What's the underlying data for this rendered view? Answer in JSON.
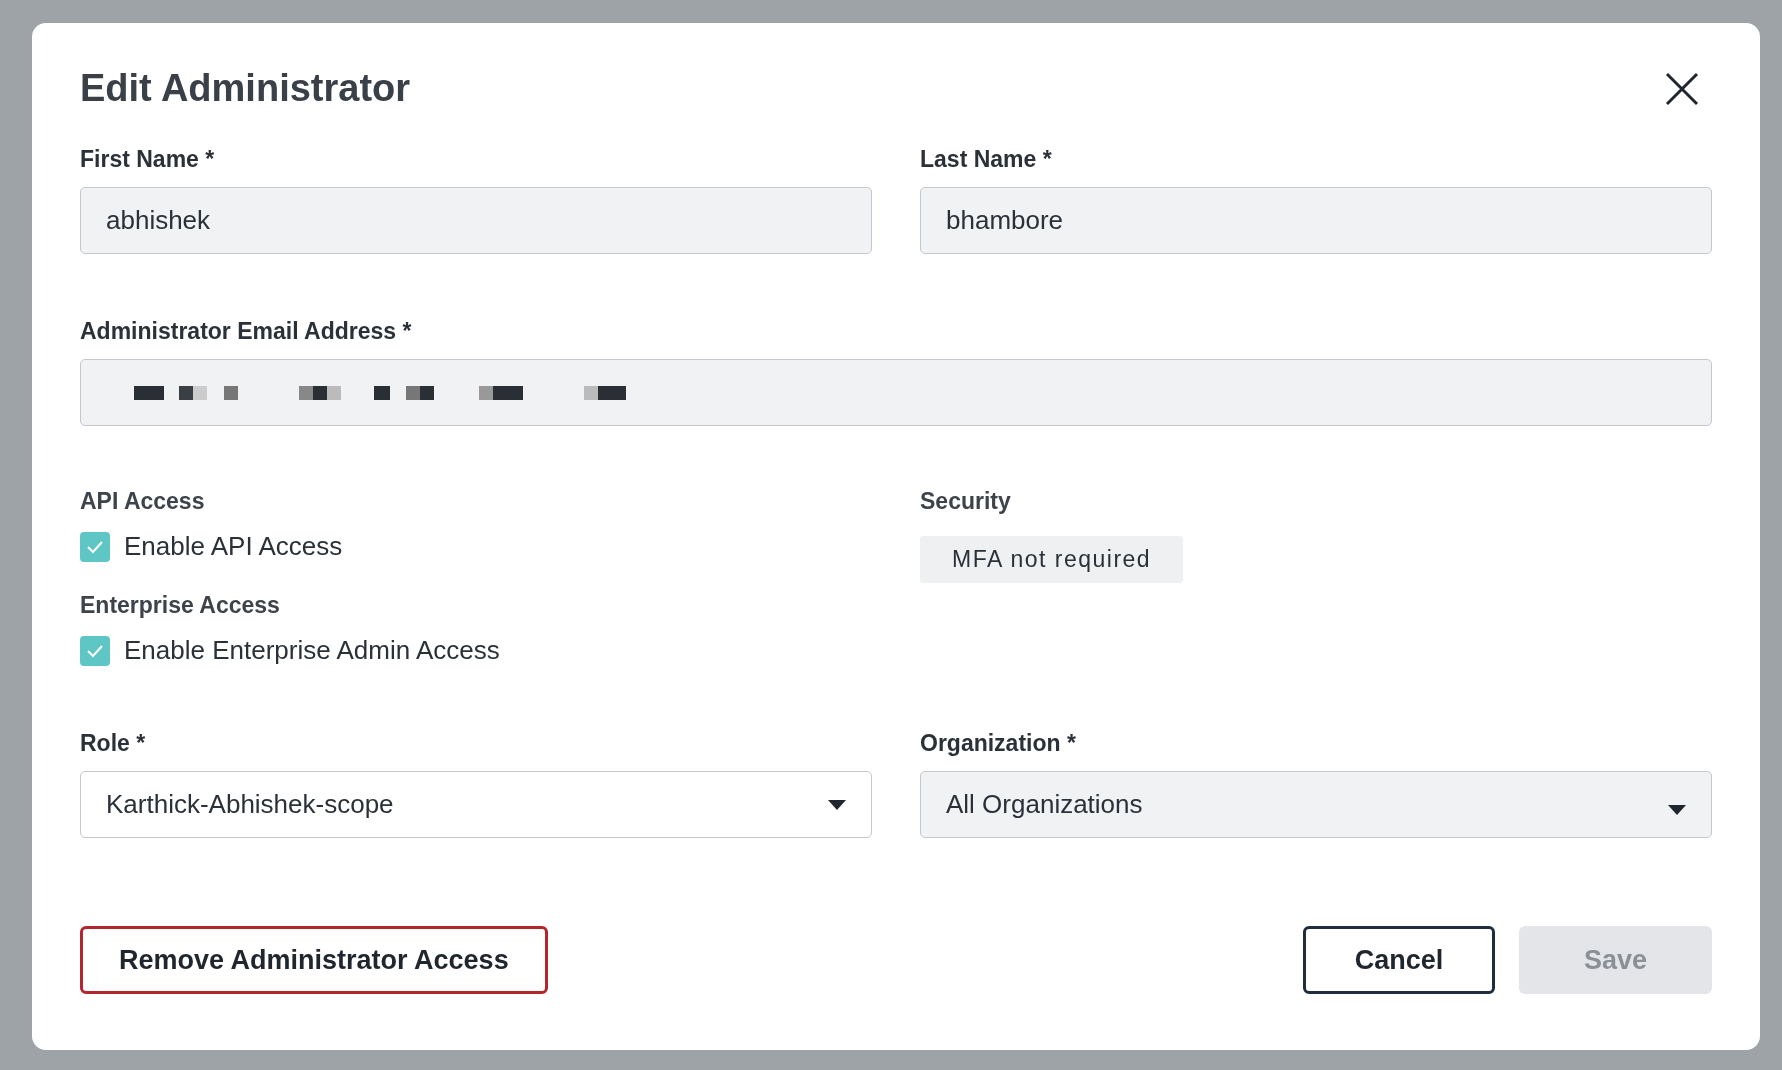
{
  "dialog": {
    "title": "Edit Administrator"
  },
  "name_fields": [
    {
      "label": "First Name *",
      "value": "abhishek",
      "disabled": true
    },
    {
      "label": "Last Name *",
      "value": "bhambore",
      "disabled": true
    }
  ],
  "email_field": {
    "label": "Administrator Email Address *",
    "disabled": true
  },
  "api_access": {
    "heading": "API Access",
    "label": "Enable API Access",
    "checked": true
  },
  "enterprise_access": {
    "heading": "Enterprise Access",
    "label": "Enable Enterprise Admin Access",
    "checked": true
  },
  "security": {
    "heading": "Security",
    "badge": "MFA not required"
  },
  "selects": [
    {
      "label": "Role *",
      "value": "Karthick-Abhishek-scope",
      "disabled": false
    },
    {
      "label": "Organization *",
      "value": "All Organizations",
      "disabled": true
    }
  ],
  "buttons": [
    {
      "kind": "danger",
      "label": "Remove Administrator Access"
    },
    {
      "kind": "secondary",
      "label": "Cancel"
    },
    {
      "kind": "primary",
      "label": "Save",
      "disabled": true
    }
  ]
}
